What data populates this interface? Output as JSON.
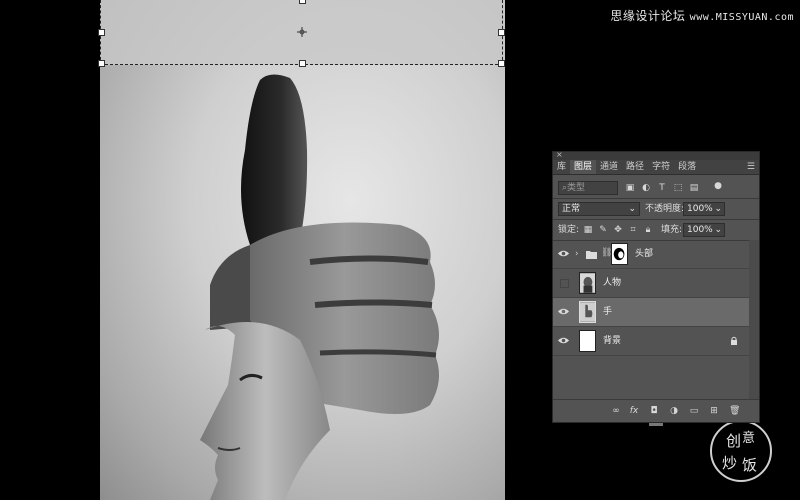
{
  "watermark": {
    "site_name": "思缘设计论坛",
    "site_url": "www.MISSYUAN.com",
    "seal_text": [
      "创",
      "意",
      "炒",
      "饭"
    ]
  },
  "layers_panel": {
    "tabs": [
      {
        "label": "库",
        "active": false
      },
      {
        "label": "图层",
        "active": true
      },
      {
        "label": "通道",
        "active": false
      },
      {
        "label": "路径",
        "active": false
      },
      {
        "label": "字符",
        "active": false
      },
      {
        "label": "段落",
        "active": false
      }
    ],
    "filter_placeholder": "类型",
    "blend_mode": "正常",
    "opacity_label": "不透明度:",
    "opacity_value": "100%",
    "lock_label": "锁定:",
    "fill_label": "填充:",
    "fill_value": "100%",
    "layers": [
      {
        "name": "头部",
        "type": "group",
        "visible": true,
        "selected": false,
        "locked": false
      },
      {
        "name": "人物",
        "type": "image",
        "visible": false,
        "selected": false,
        "locked": false
      },
      {
        "name": "手",
        "type": "image",
        "visible": true,
        "selected": true,
        "locked": false
      },
      {
        "name": "背景",
        "type": "fill",
        "visible": true,
        "selected": false,
        "locked": true
      }
    ],
    "bottom_buttons": [
      "link-icon",
      "fx-icon",
      "mask-icon",
      "adjustment-icon",
      "folder-icon",
      "new-layer-icon",
      "trash-icon"
    ],
    "fx_label": "fx"
  },
  "colors": {
    "panel_bg": "#535353",
    "panel_tab_bg": "#424242",
    "selected_layer": "#6a6a6a",
    "canvas_light": "#e6e6e6"
  }
}
